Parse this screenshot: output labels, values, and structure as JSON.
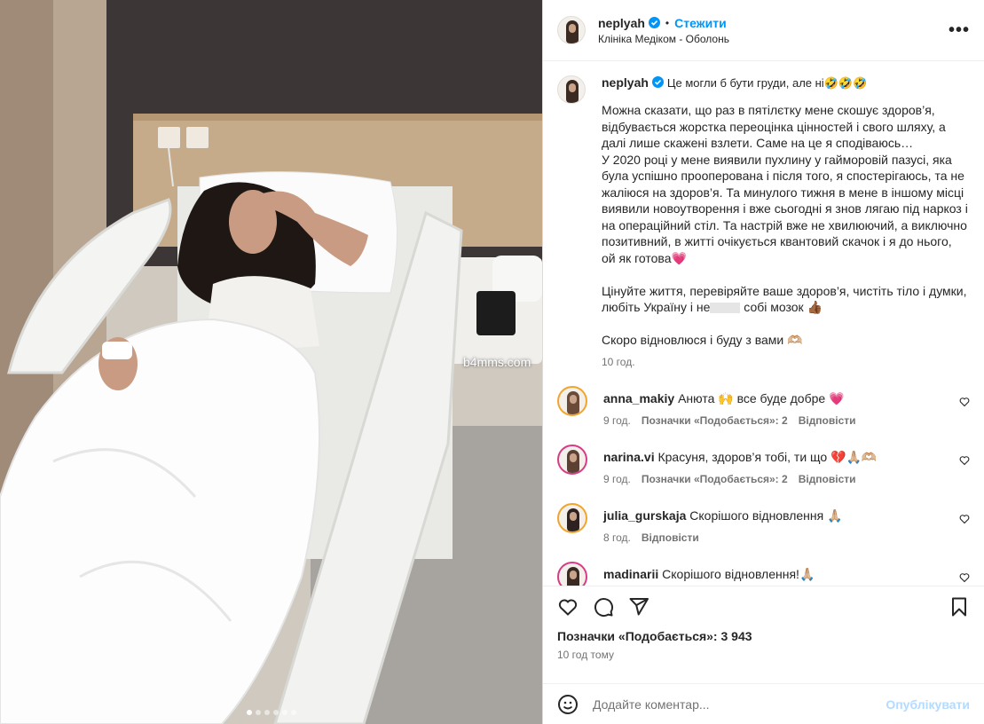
{
  "watermark": "b4mms.com",
  "carousel": {
    "count": 6,
    "active_index": 0
  },
  "header": {
    "username": "neplyah",
    "separator": "•",
    "follow_label": "Стежити",
    "location": "Клініка Медіком - Оболонь",
    "more_label": "•••"
  },
  "caption": {
    "username": "neplyah",
    "title_text": "Це могли б бути груди, але ні🤣🤣🤣",
    "text_part1": "Можна сказати, що раз в пятілєтку мене скошує здоров’я, відбувається жорстка переоцінка цінностей і свого шляху, а далі лише скажені взлети. Саме на це я сподіваюсь…\nУ 2020 році у мене виявили пухлину у гайморовій пазусі, яка була успішно прооперована і після того, я спостерігаюсь, та не жаліюся на здоров’я. Та минулого тижня в мене в іншому місці виявили новоутворення і вже сьогодні я знов лягаю під наркоз і на операційний стіл. Та настрій вже не хвилюючий, а виключно позитивний, в житті очікується квантовий скачок і я до нього, ой як готова💗\n\nЦінуйте життя, перевіряйте ваше здоров’я, чистіть тіло і думки, любіть Україну і не",
    "text_part2": " собі мозок 👍🏾\n\nСкоро відновлюся і буду з вами 🫶🏼",
    "time": "10 год."
  },
  "comments": [
    {
      "username": "anna_makiy",
      "text": "Анюта 🙌 все буде добре 💗",
      "time": "9 год.",
      "likes": "Позначки «Подобається»: 2",
      "reply": "Відповісти"
    },
    {
      "username": "narina.vi",
      "text": "Красуня, здоров’я тобі, ти що 💔🙏🏼🫶🏼",
      "time": "9 год.",
      "likes": "Позначки «Подобається»: 2",
      "reply": "Відповісти"
    },
    {
      "username": "julia_gurskaja",
      "text": "Скорішого відновлення 🙏🏼",
      "time": "8 год.",
      "likes": "",
      "reply": "Відповісти"
    },
    {
      "username": "madinarii",
      "text": "Скорішого відновлення!🙏🏼",
      "time": "",
      "likes": "",
      "reply": ""
    }
  ],
  "actions": {
    "likes_total": "Позначки «Подобається»: 3 943",
    "post_time": "10 год тому"
  },
  "comment_box": {
    "placeholder": "Додайте коментар...",
    "publish_label": "Опублікувати"
  },
  "icons": [
    "verified-badge-icon",
    "heart-icon",
    "comment-icon",
    "share-icon",
    "bookmark-icon",
    "smile-icon",
    "more-icon"
  ],
  "colors": {
    "accent": "#0095f6",
    "publish_disabled": "#b3dbff",
    "verified": "#0095f6",
    "secondary_text": "#737373"
  }
}
